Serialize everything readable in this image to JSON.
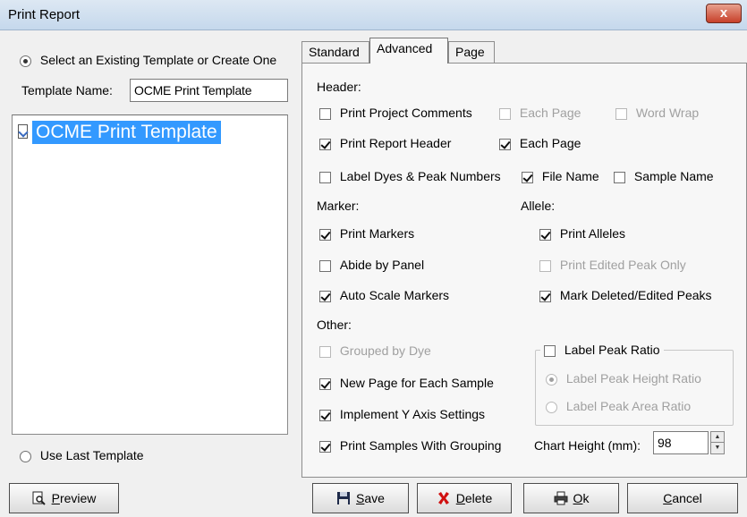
{
  "window": {
    "title": "Print Report",
    "close_glyph": "x"
  },
  "left": {
    "select_existing": "Select an Existing Template or Create One",
    "template_name_label": "Template Name:",
    "template_name_value": "OCME Print Template",
    "tree_item": "OCME Print Template",
    "use_last": "Use Last Template"
  },
  "tabs": [
    "Standard",
    "Advanced",
    "Page"
  ],
  "advanced": {
    "header_section": "Header:",
    "print_project_comments": "Print Project Comments",
    "each_page_1": "Each Page",
    "word_wrap": "Word Wrap",
    "print_report_header": "Print Report Header",
    "each_page_2": "Each Page",
    "label_dyes": "Label Dyes & Peak Numbers",
    "file_name": "File Name",
    "sample_name": "Sample Name",
    "marker_section": "Marker:",
    "allele_section": "Allele:",
    "print_markers": "Print Markers",
    "print_alleles": "Print Alleles",
    "abide_by_panel": "Abide by Panel",
    "print_edited_peak_only": "Print Edited Peak Only",
    "auto_scale_markers": "Auto Scale Markers",
    "mark_deleted_edited": "Mark Deleted/Edited Peaks",
    "other_section": "Other:",
    "grouped_by_dye": "Grouped by Dye",
    "label_peak_ratio": "Label Peak Ratio",
    "new_page_each_sample": "New Page for Each Sample",
    "label_peak_height_ratio": "Label Peak Height Ratio",
    "implement_y_axis": "Implement  Y Axis Settings",
    "label_peak_area_ratio": "Label Peak Area Ratio",
    "print_samples_grouping": "Print Samples With Grouping",
    "chart_height_label": "Chart Height (mm):",
    "chart_height_value": "98"
  },
  "buttons": {
    "preview_pre": "",
    "preview_key": "P",
    "preview_post": "review",
    "save_key": "S",
    "save_post": "ave",
    "delete_key": "D",
    "delete_post": "elete",
    "ok_key": "O",
    "ok_post": "k",
    "cancel_key": "C",
    "cancel_post": "ancel"
  },
  "icons": {
    "preview": "magnifier-page-icon",
    "save": "floppy-disk-icon",
    "delete": "red-x-icon",
    "ok": "printer-icon"
  },
  "colors": {
    "selection": "#3399ff",
    "delete_x": "#d01010"
  }
}
